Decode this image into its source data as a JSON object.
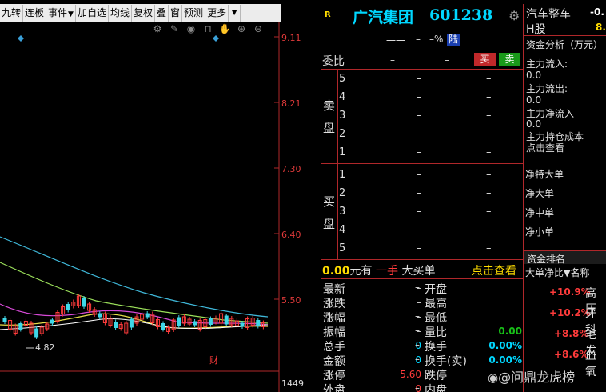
{
  "toolbar": {
    "items": [
      "九转",
      "连板",
      "事件",
      "加自选",
      "均线",
      "复权",
      "叠",
      "窗",
      "预测",
      "更多"
    ],
    "event_arrow": "▼",
    "more_arrow": "▼"
  },
  "chart_icons": [
    "gear-icon",
    "brush-icon",
    "eye-icon",
    "lock-icon",
    "hand-icon",
    "zoom-in-icon",
    "zoom-out-icon"
  ],
  "price_axis": [
    "9.11",
    "8.21",
    "7.30",
    "6.40",
    "5.50"
  ],
  "volume_label": "1449",
  "low_marker": "4.82",
  "fin_marker": "财",
  "stock": {
    "badge": "R",
    "name": "广汽集团",
    "code": "601238",
    "sub_dash1": "一一",
    "sub_dash2": "–",
    "sub_pct": "–%",
    "market": "陆"
  },
  "order_book": {
    "ratio_label": "委比",
    "ratio_dash1": "–",
    "ratio_dash2": "–",
    "buy_btn": "买",
    "sell_btn": "卖",
    "sell_label": "卖盘",
    "buy_label": "买盘",
    "sell_levels": [
      "5",
      "4",
      "3",
      "2",
      "1"
    ],
    "buy_levels": [
      "1",
      "2",
      "3",
      "4",
      "5"
    ],
    "dash": "–"
  },
  "big_order": {
    "amount": "0.00",
    "unit": "元有",
    "hand": "一手",
    "label": "大买单",
    "link": "点击查看"
  },
  "quote": {
    "left": [
      {
        "label": "最新",
        "value": "–"
      },
      {
        "label": "涨跌",
        "value": "–"
      },
      {
        "label": "涨幅",
        "value": "–"
      },
      {
        "label": "振幅",
        "value": "–"
      },
      {
        "label": "总手",
        "value": "0"
      },
      {
        "label": "金额",
        "value": "0"
      },
      {
        "label": "涨停",
        "value": "5.60"
      },
      {
        "label": "外盘",
        "value": "0"
      }
    ],
    "right": [
      {
        "label": "开盘",
        "value": ""
      },
      {
        "label": "最高",
        "value": ""
      },
      {
        "label": "最低",
        "value": ""
      },
      {
        "label": "量比",
        "value": "0.00"
      },
      {
        "label": "换手",
        "value": "0.00%"
      },
      {
        "label": "换手(实)",
        "value": "0.00%"
      },
      {
        "label": "跌停",
        "value": ""
      },
      {
        "label": "内盘",
        "value": ""
      }
    ],
    "dashes": [
      "–",
      "–",
      "–",
      "–",
      "–",
      "–",
      "–",
      "–"
    ]
  },
  "sector": {
    "name": "汽车整车",
    "change": "-0.",
    "sub_label": "H股",
    "sub_value": "8."
  },
  "capital": {
    "title": "资金分析（万元）",
    "inflow_label": "主力流入:",
    "inflow_value": "0.0",
    "outflow_label": "主力流出:",
    "outflow_value": "0.0",
    "net_label": "主力净流入",
    "net_value": "0.0",
    "cost_label": "主力持仓成本",
    "cost_link": "点击查看",
    "nets": [
      "净特大单",
      "净大单",
      "净中单",
      "净小单"
    ]
  },
  "ranking": {
    "title": "资金排名",
    "col1": "大单净比",
    "sort_icon": "down-arrow-icon",
    "col2": "名称",
    "rows": [
      {
        "pct": "+10.9%",
        "name": "高压"
      },
      {
        "pct": "+10.2%",
        "name": "牙科"
      },
      {
        "pct": "+8.8%",
        "name": "毛发"
      },
      {
        "pct": "+8.6%",
        "name": "血氧"
      }
    ]
  },
  "watermark": "@问鼎龙虎榜",
  "colors": {
    "up": "#ff3b3b",
    "down": "#18c018",
    "axis": "#b0272a",
    "title": "#00d7ff",
    "accent": "#ffdc00"
  }
}
